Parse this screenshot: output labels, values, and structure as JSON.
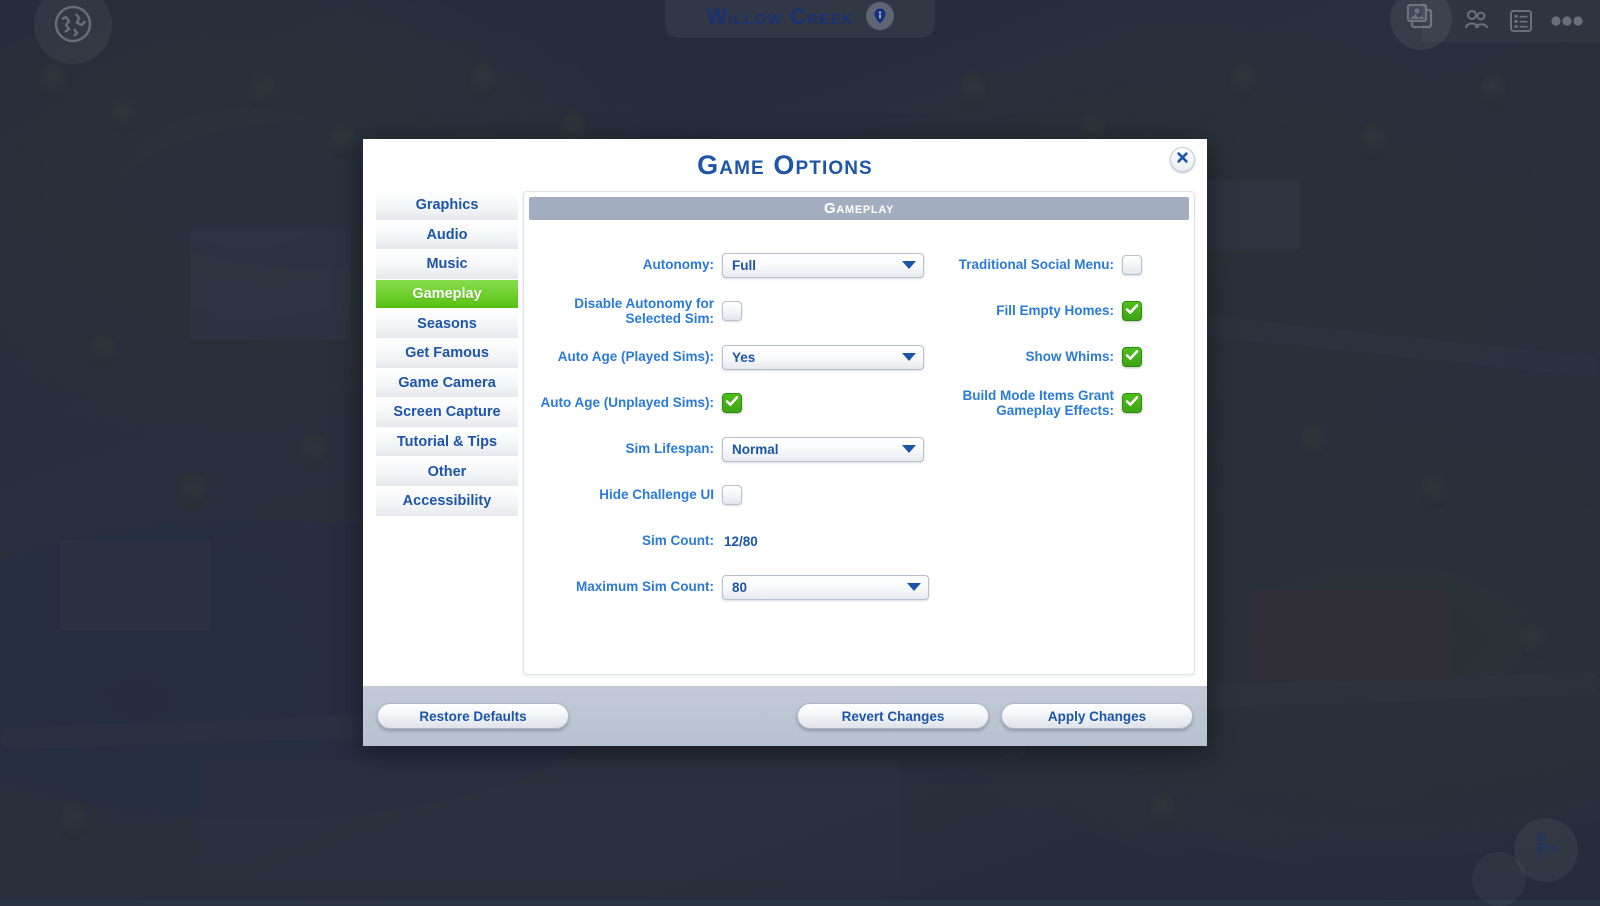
{
  "game_hud": {
    "world_icon": "globe-icon",
    "place_name": "Willow Creek",
    "place_pin_icon": "map-pin-info-icon",
    "gallery_icon": "gallery-photos-icon",
    "relationships_icon": "sims-relationships-icon",
    "list_icon": "list-panel-icon",
    "more_icon": "more-options-icon",
    "travel_icon": "travel-sim-icon"
  },
  "dialog": {
    "title": "Game Options",
    "close_icon": "close-x-icon",
    "section_header": "Gameplay"
  },
  "sidebar": {
    "items": [
      {
        "label": "Graphics",
        "active": false
      },
      {
        "label": "Audio",
        "active": false
      },
      {
        "label": "Music",
        "active": false
      },
      {
        "label": "Gameplay",
        "active": true
      },
      {
        "label": "Seasons",
        "active": false
      },
      {
        "label": "Get Famous",
        "active": false
      },
      {
        "label": "Game Camera",
        "active": false
      },
      {
        "label": "Screen Capture",
        "active": false
      },
      {
        "label": "Tutorial & Tips",
        "active": false
      },
      {
        "label": "Other",
        "active": false
      },
      {
        "label": "Accessibility",
        "active": false
      }
    ]
  },
  "options": {
    "left": [
      {
        "label": "Autonomy:",
        "type": "dropdown",
        "value": "Full"
      },
      {
        "label": "Disable Autonomy for Selected Sim:",
        "type": "checkbox",
        "checked": false
      },
      {
        "label": "Auto Age (Played Sims):",
        "type": "dropdown",
        "value": "Yes"
      },
      {
        "label": "Auto Age (Unplayed Sims):",
        "type": "checkbox",
        "checked": true
      },
      {
        "label": "Sim Lifespan:",
        "type": "dropdown",
        "value": "Normal"
      },
      {
        "label": "Hide Challenge UI",
        "type": "checkbox",
        "checked": false
      },
      {
        "label": "Sim Count:",
        "type": "text",
        "value": "12/80"
      },
      {
        "label": "Maximum Sim Count:",
        "type": "dropdown",
        "value": "80"
      }
    ],
    "right": [
      {
        "label": "Traditional Social Menu:",
        "type": "checkbox",
        "checked": false
      },
      {
        "label": "Fill Empty Homes:",
        "type": "checkbox",
        "checked": true
      },
      {
        "label": "Show Whims:",
        "type": "checkbox",
        "checked": true
      },
      {
        "label": "Build Mode Items Grant Gameplay Effects:",
        "type": "checkbox",
        "checked": true
      }
    ]
  },
  "footer": {
    "restore_defaults": "Restore Defaults",
    "revert_changes": "Revert Changes",
    "apply_changes": "Apply Changes"
  },
  "colors": {
    "accent_blue": "#1d55a8",
    "label_blue": "#2a7bd6",
    "active_green": "#6ecf2c",
    "checkbox_green": "#3ea514",
    "section_header_gray": "#a3adc0"
  }
}
